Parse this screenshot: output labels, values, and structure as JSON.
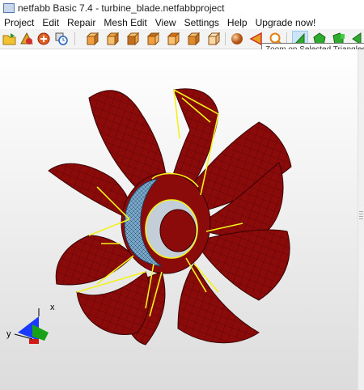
{
  "window": {
    "title": "netfabb Basic 7.4 - turbine_blade.netfabbproject"
  },
  "menu": [
    "Project",
    "Edit",
    "Repair",
    "Mesh Edit",
    "View",
    "Settings",
    "Help",
    "Upgrade now!"
  ],
  "toolbar": {
    "buttons": [
      {
        "name": "open-project-icon"
      },
      {
        "name": "add-part-icon"
      },
      {
        "name": "repair-icon"
      },
      {
        "name": "measure-clock-icon"
      },
      {
        "name": "view-front-icon"
      },
      {
        "name": "view-back-icon"
      },
      {
        "name": "view-left-icon"
      },
      {
        "name": "view-right-icon"
      },
      {
        "name": "view-top-icon"
      },
      {
        "name": "view-bottom-icon"
      },
      {
        "name": "view-perspective-icon"
      },
      {
        "name": "select-sphere-icon"
      },
      {
        "name": "triangle-select-icon"
      },
      {
        "name": "zoom-selected-icon"
      },
      {
        "name": "select-triangle-tool-icon"
      },
      {
        "name": "select-surface-icon"
      },
      {
        "name": "select-shell-icon"
      },
      {
        "name": "select-extra-icon"
      }
    ],
    "tooltip": "Zoom on Selected Triangles"
  },
  "viewport": {
    "axis_labels": {
      "x": "x",
      "y": "y"
    },
    "colors": {
      "mesh": "#8b0a0a",
      "edges": "#f2f21a",
      "inner": "#7ba7c9"
    }
  }
}
